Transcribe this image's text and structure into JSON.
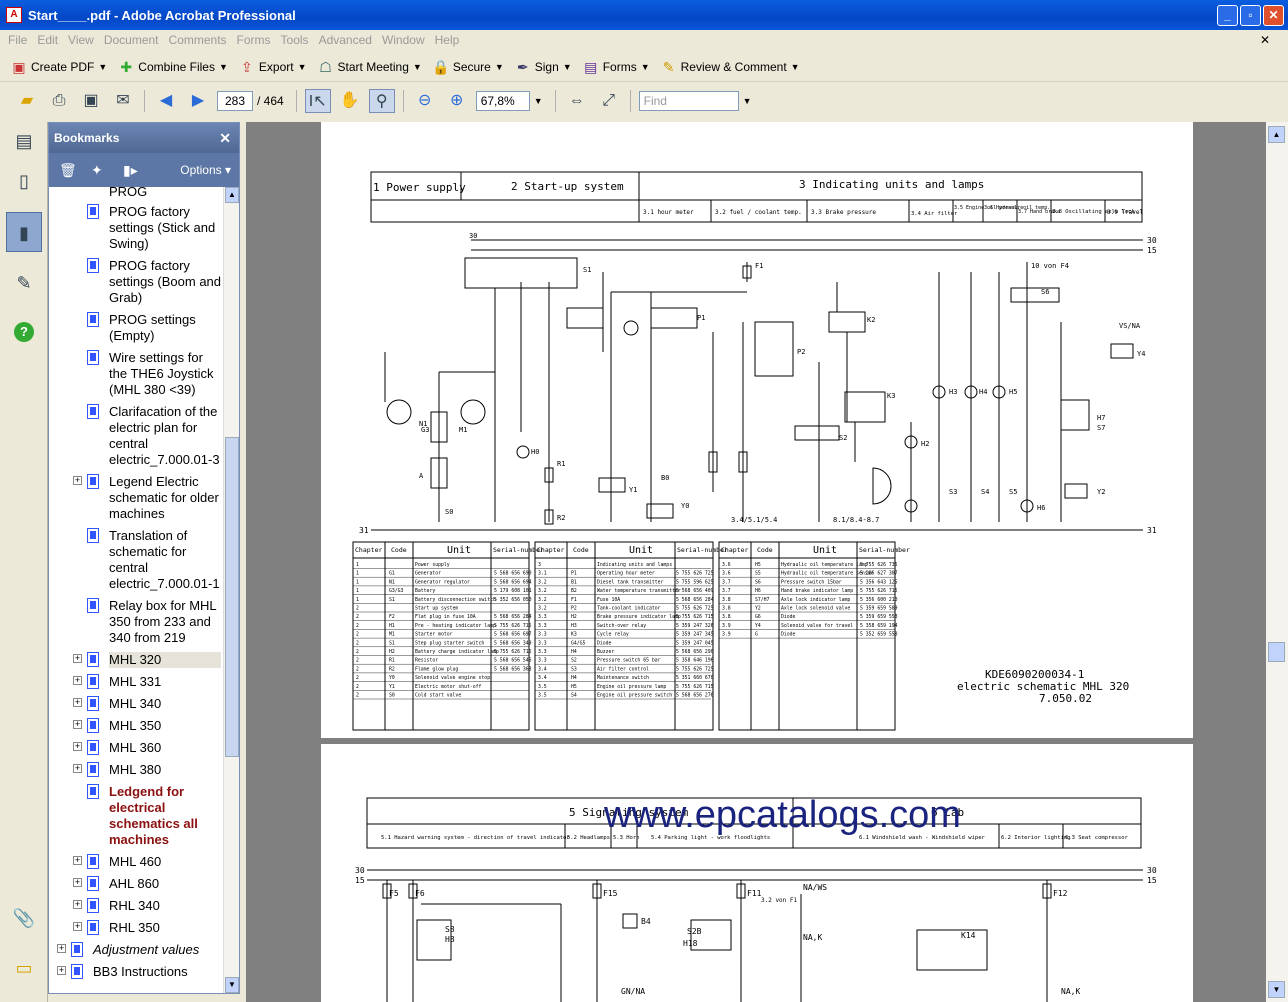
{
  "window": {
    "title": "Start____.pdf - Adobe Acrobat Professional"
  },
  "menu": [
    "File",
    "Edit",
    "View",
    "Document",
    "Comments",
    "Forms",
    "Tools",
    "Advanced",
    "Window",
    "Help"
  ],
  "toolbar1": [
    {
      "label": "Create PDF",
      "icon": "create-pdf-icon"
    },
    {
      "label": "Combine Files",
      "icon": "combine-files-icon"
    },
    {
      "label": "Export",
      "icon": "export-icon"
    },
    {
      "label": "Start Meeting",
      "icon": "meeting-icon"
    },
    {
      "label": "Secure",
      "icon": "lock-icon"
    },
    {
      "label": "Sign",
      "icon": "pen-icon"
    },
    {
      "label": "Forms",
      "icon": "forms-icon"
    },
    {
      "label": "Review & Comment",
      "icon": "review-icon"
    }
  ],
  "toolbar2": {
    "page_current": "283",
    "page_total": "/ 464",
    "zoom": "67,8%",
    "find_placeholder": "Find"
  },
  "bookmarks": {
    "title": "Bookmarks",
    "options": "Options",
    "items": [
      "PROG",
      "PROG factory settings (Stick and Swing)",
      "PROG factory settings (Boom and Grab)",
      "PROG settings (Empty)",
      "Wire settings for the THE6 Joystick (MHL 380 <39)",
      "Clarifacation of the electric plan for central electric_7.000.01-3",
      "Legend Electric schematic for older machines",
      "Translation of schematic for central electric_7.000.01-1",
      "Relay box for MHL 350 from 233 and 340 from 219",
      "MHL 320",
      "MHL 331",
      "MHL 340",
      "MHL 350",
      "MHL 360",
      "MHL 380",
      "Ledgend for electrical schematics all machines",
      "MHL 460",
      "AHL 860",
      "RHL 340",
      "RHL 350",
      "Adjustment values",
      "BB3 Instructions"
    ]
  },
  "schematic1": {
    "sections": [
      "1 Power supply",
      "2 Start-up system",
      "3 Indicating units and lamps"
    ],
    "subsections": [
      "3.1 hour meter",
      "3.2 fuel / coolant temp.",
      "3.3 Brake pressure",
      "3.4 Air filter",
      "3.5 Engine oil pressure",
      "3.6 Hydraul. oil temp.",
      "3.7 Hand brake",
      "3.8 Oscillating axle lock",
      "3.9 Travel"
    ],
    "rails": [
      "30",
      "15",
      "31"
    ],
    "table_headers": [
      "Chapter",
      "Code",
      "Unit",
      "Serial-number"
    ],
    "table_left": [
      [
        "1",
        "",
        "Power supply",
        ""
      ],
      [
        "1",
        "G1",
        "Generator",
        "5 568 656 690"
      ],
      [
        "1",
        "N1",
        "Generator regulator",
        "5 568 656 694"
      ],
      [
        "1",
        "G3/G3",
        "Battery",
        "5 179 608 101"
      ],
      [
        "1",
        "S1",
        "Battery disconnection switch",
        "5 352 656 050"
      ],
      [
        "2",
        "",
        "Start up system",
        ""
      ],
      [
        "2",
        "F2",
        "Flat plug in fuse 10A",
        "5 568 656 284"
      ],
      [
        "2",
        "H1",
        "Pre - heating indicator lamp",
        "5 755 626 715"
      ],
      [
        "2",
        "M1",
        "Starter motor",
        "5 568 656 697"
      ],
      [
        "2",
        "S1",
        "Step plug starter switch",
        "5 568 656 349"
      ],
      [
        "2",
        "H2",
        "Battery charge indicator lamp",
        "5 755 626 715"
      ],
      [
        "2",
        "R1",
        "Resistor",
        "5 568 656 546"
      ],
      [
        "2",
        "R2",
        "Flame glow plug",
        "5 568 656 363"
      ],
      [
        "2",
        "Y0",
        "Solenoid valve engine stop",
        ""
      ],
      [
        "2",
        "Y1",
        "Electric motor shut-off",
        ""
      ],
      [
        "2",
        "S0",
        "Cold start valve",
        ""
      ]
    ],
    "table_mid": [
      [
        "3",
        "",
        "Indicating units and lamps",
        ""
      ],
      [
        "3.1",
        "P1",
        "Operating hour meter",
        "5 755 626 725"
      ],
      [
        "3.2",
        "B1",
        "Diesel tank transmitter",
        "5 755 596 625"
      ],
      [
        "3.2",
        "B2",
        "Water temperature transmitter",
        "5 568 656 409"
      ],
      [
        "3.2",
        "F1",
        "Fuse 10A",
        "5 568 656 284"
      ],
      [
        "3.2",
        "P2",
        "Tank-coolant indicator",
        "5 755 626 725"
      ],
      [
        "3.3",
        "H2",
        "Brake pressure indicator lamp",
        "5 755 626 715"
      ],
      [
        "3.3",
        "H3",
        "Switch-over relay",
        "5 359 247 326"
      ],
      [
        "3.3",
        "K3",
        "Cycle relay",
        "5 359 247 345"
      ],
      [
        "3.3",
        "G4/G5",
        "Diode",
        "5 359 247 045"
      ],
      [
        "3.3",
        "H4",
        "Buzzer",
        "5 568 656 290"
      ],
      [
        "3.3",
        "S2",
        "Pressure switch 65 bar",
        "5 358 646 196"
      ],
      [
        "3.4",
        "S3",
        "Air filter control",
        "5 755 626 725"
      ],
      [
        "3.4",
        "H4",
        "Maintenance switch",
        "5 351 660 670"
      ],
      [
        "3.5",
        "H5",
        "Engine oil pressure lamp",
        "5 755 626 715"
      ],
      [
        "3.5",
        "S4",
        "Engine oil pressure switch",
        "5 568 656 276"
      ]
    ],
    "table_right": [
      [
        "3.6",
        "H5",
        "Hydraulic oil temperature lamp",
        "5 755 626 735"
      ],
      [
        "3.6",
        "S5",
        "Hydraulic oil temperature sensor",
        "5 286 627 307"
      ],
      [
        "3.7",
        "S6",
        "Pressure switch 15bar",
        "5 356 643 125"
      ],
      [
        "3.7",
        "H6",
        "Hand brake indicator lamp",
        "5 755 626 715"
      ],
      [
        "3.8",
        "S7/H7",
        "Axle lock indicator lamp",
        "5 356 600 210"
      ],
      [
        "3.8",
        "Y2",
        "Axle lock solenoid valve",
        "5 359 659 589"
      ],
      [
        "3.8",
        "G6",
        "Diode",
        "5 359 659 558"
      ],
      [
        "3.9",
        "Y4",
        "Solenoid valve for travel",
        "5 358 659 194"
      ],
      [
        "3.9",
        "G",
        "Diode",
        "5 352 659 558"
      ]
    ],
    "doc_id": "KDE6090200034-1",
    "doc_title": "electric schematic MHL 320",
    "doc_ver": "7.050.02"
  },
  "schematic2": {
    "sections": [
      "5 Signaling system",
      "6 Cab"
    ],
    "subsections": [
      "5.1 Hazard warning system - direction of travel indicator",
      "5.2 Headlamps",
      "5.3 Horn",
      "5.4 Parking light - work floodlights",
      "6.1 Windshield wash - Windshield wiper",
      "6.2 Interior lighting",
      "6.3 Seat compressor"
    ],
    "rails": [
      "30",
      "15"
    ],
    "labels": [
      "F5",
      "F6",
      "F15",
      "F11",
      "F12",
      "S8",
      "H8",
      "B4",
      "S2B",
      "H18",
      "NA/WS",
      "NA,K",
      "K14",
      "GN/NA",
      "NA,K",
      "3.2 von F1"
    ]
  },
  "watermark": "www.epcatalogs.com",
  "colors": {
    "titlebar": "#0a5ee0",
    "bookmark_header": "#5c77a6",
    "doc_bg": "#808080",
    "highlight_bookmark": "#8b1010",
    "watermark": "#1a237e"
  }
}
